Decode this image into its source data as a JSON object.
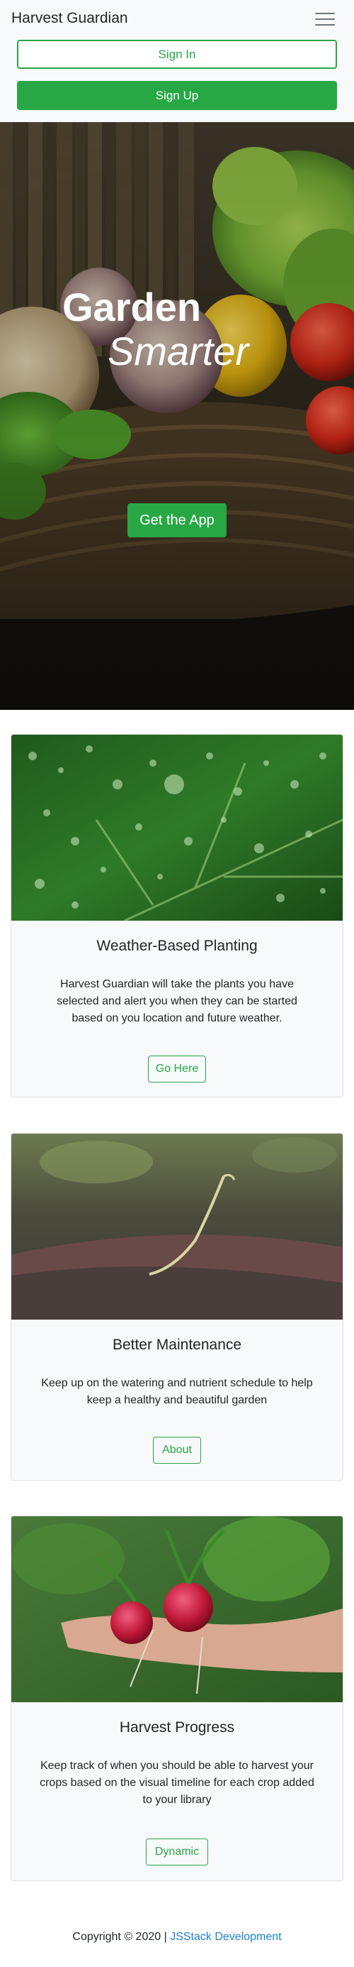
{
  "navbar": {
    "brand": "Harvest Guardian",
    "toggle_icon": "hamburger-menu-icon",
    "sign_in_label": "Sign In",
    "sign_up_label": "Sign Up"
  },
  "hero": {
    "title_line1": "Garden",
    "title_line2": "Smarter",
    "cta_label": "Get the App"
  },
  "cards": [
    {
      "title": "Weather-Based Planting",
      "text": "Harvest Guardian will take the plants you have selected and alert you when they can be started based on you location and future weather.",
      "button_label": "Go Here"
    },
    {
      "title": "Better Maintenance",
      "text": "Keep up on the watering and nutrient schedule to help keep a healthy and beautiful garden",
      "button_label": "About"
    },
    {
      "title": "Harvest Progress",
      "text": "Keep track of when you should be able to harvest your crops based on the visual timeline for each crop added to your library",
      "button_label": "Dynamic"
    }
  ],
  "footer": {
    "copyright": "Copyright © 2020 |",
    "link_label": "JSStack Development"
  },
  "colors": {
    "accent": "#28a745",
    "navbar_bg": "#f8f9fa",
    "link": "#1e7fd6"
  }
}
